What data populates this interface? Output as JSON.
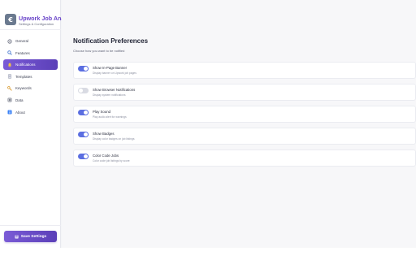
{
  "app": {
    "title": "Upwork Job Analyzer",
    "subtitle": "Settings & Configuration",
    "logo_glyph": "€"
  },
  "sidebar": {
    "items": [
      {
        "label": "General",
        "icon": "gear-icon",
        "active": false
      },
      {
        "label": "Features",
        "icon": "magnifier-icon",
        "active": false
      },
      {
        "label": "Notifications",
        "icon": "bell-icon",
        "active": true
      },
      {
        "label": "Templates",
        "icon": "document-icon",
        "active": false
      },
      {
        "label": "Keywords",
        "icon": "key-icon",
        "active": false
      },
      {
        "label": "Data",
        "icon": "database-icon",
        "active": false
      },
      {
        "label": "About",
        "icon": "info-icon",
        "active": false
      }
    ],
    "save_label": "Save Settings"
  },
  "main": {
    "title": "Notification Preferences",
    "description": "Choose how you want to be notified",
    "settings": [
      {
        "label": "Show In-Page Banner",
        "description": "Display banner on Upwork job pages",
        "enabled": true
      },
      {
        "label": "Show Browser Notifications",
        "description": "Display system notifications",
        "enabled": false
      },
      {
        "label": "Play Sound",
        "description": "Play audio alert for warnings",
        "enabled": true
      },
      {
        "label": "Show Badges",
        "description": "Display color badges on job listings",
        "enabled": true
      },
      {
        "label": "Color Code Jobs",
        "description": "Color code job listings by score",
        "enabled": true
      }
    ]
  },
  "colors": {
    "accent": "#6a45c9",
    "toggle_on": "#5b6ee1",
    "toggle_off": "#d9dbe3"
  }
}
